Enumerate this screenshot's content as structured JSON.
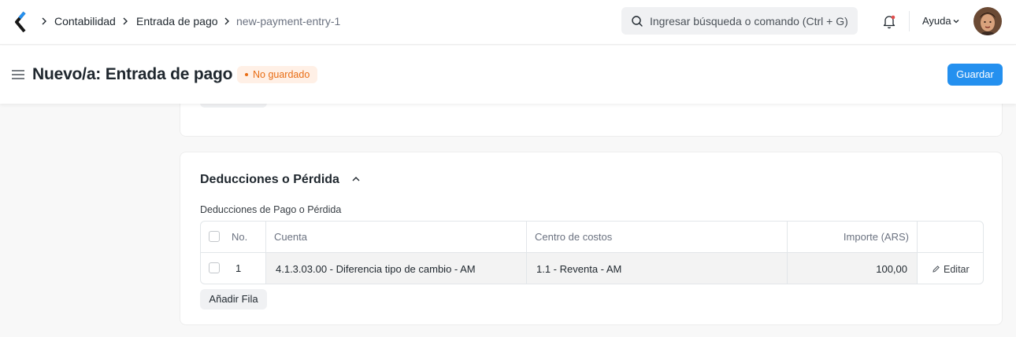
{
  "navbar": {
    "breadcrumbs": [
      "Contabilidad",
      "Entrada de pago",
      "new-payment-entry-1"
    ],
    "search_placeholder": "Ingresar búsqueda o comando (Ctrl + G)",
    "help_label": "Ayuda",
    "icons": [
      "app-logo",
      "chevron-right-icon",
      "search-icon",
      "bell-icon",
      "chevron-down-icon",
      "avatar"
    ]
  },
  "page": {
    "title": "Nuevo/a: Entrada de pago",
    "status_badge": "No guardado",
    "save_label": "Guardar",
    "colors": {
      "primary": "#2490ef",
      "badge_text": "#e86c13",
      "badge_bg": "#fff0e6"
    }
  },
  "section": {
    "title": "Deducciones o Pérdida",
    "table_label": "Deducciones de Pago o Pérdida",
    "columns": {
      "no": "No.",
      "account": "Cuenta",
      "cost_center": "Centro de costos",
      "amount": "Importe (ARS)"
    },
    "rows": [
      {
        "no": "1",
        "account": "4.1.3.03.00 - Diferencia tipo de cambio - AM",
        "cost_center": "1.1 - Reventa - AM",
        "amount": "100,00",
        "edit_label": "Editar"
      }
    ],
    "add_row_label": "Añadir Fila"
  }
}
